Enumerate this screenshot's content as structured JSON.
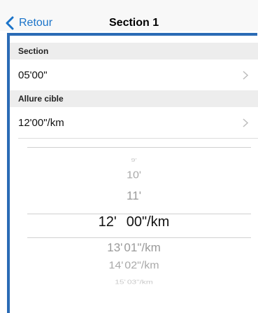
{
  "navbar": {
    "back_label": "Retour",
    "title": "Section 1"
  },
  "groups": [
    {
      "header": "Section",
      "value": "05'00\""
    },
    {
      "header": "Allure cible",
      "value": "12'00\"/km"
    }
  ],
  "picker": {
    "rows": [
      {
        "min": "9'",
        "sec": ""
      },
      {
        "min": "10'",
        "sec": ""
      },
      {
        "min": "11'",
        "sec": ""
      },
      {
        "min": "12'",
        "sec": "00\"/km"
      },
      {
        "min": "13'",
        "sec": "01\"/km"
      },
      {
        "min": "14'",
        "sec": "02\"/km"
      },
      {
        "min": "15'",
        "sec": "03\"/km"
      }
    ],
    "selected_index": 3
  },
  "colors": {
    "accent": "#1a73c9",
    "frame": "#2b6bb5"
  }
}
